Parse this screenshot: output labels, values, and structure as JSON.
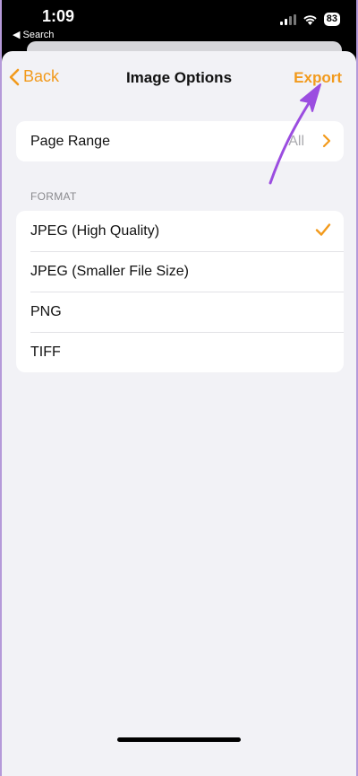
{
  "status_bar": {
    "time": "1:09",
    "back_app": "Search",
    "battery": "83"
  },
  "nav": {
    "back_label": "Back",
    "title": "Image Options",
    "export_label": "Export"
  },
  "page_range": {
    "label": "Page Range",
    "value": "All"
  },
  "format": {
    "header": "FORMAT",
    "options": [
      {
        "label": "JPEG (High Quality)",
        "selected": true
      },
      {
        "label": "JPEG (Smaller File Size)",
        "selected": false
      },
      {
        "label": "PNG",
        "selected": false
      },
      {
        "label": "TIFF",
        "selected": false
      }
    ]
  },
  "colors": {
    "accent": "#f29a1c",
    "annotation_arrow": "#9b4de0",
    "background": "#b59ad9"
  }
}
